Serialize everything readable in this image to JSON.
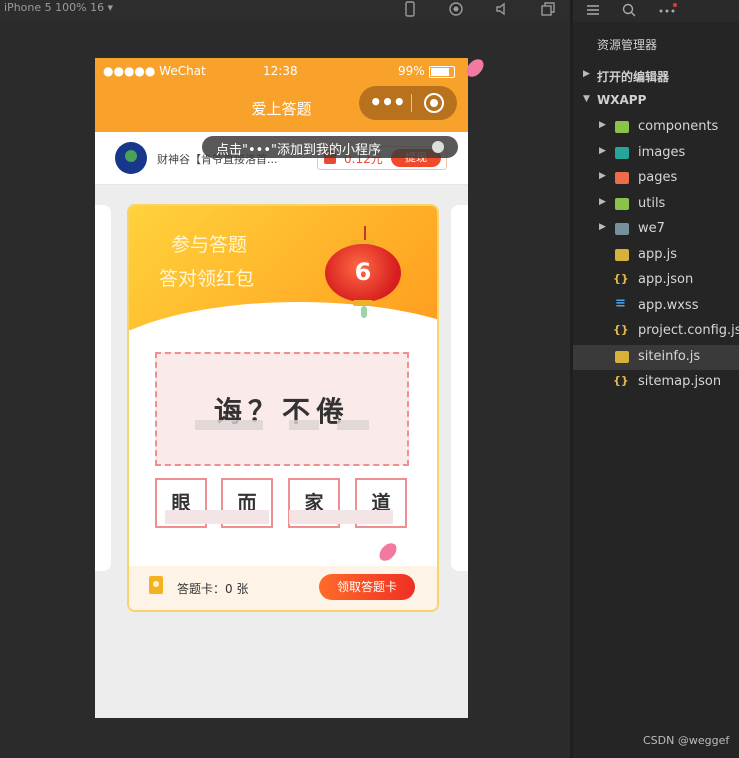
{
  "toolbar": {
    "device": "iPhone 5 100% 16 ▾"
  },
  "phone": {
    "status": {
      "carrier": "●●●●● WeChat",
      "time": "12:38",
      "battery_text": "99%"
    },
    "nav": {
      "title": "爱上答题",
      "capsule_more": "•••"
    },
    "ad": {
      "text": "财神谷【肯爷直接洛首...",
      "amount": "0.12元",
      "button": "提现"
    },
    "tip": {
      "text": "点击\"•••\"添加到我的小程序"
    },
    "card": {
      "head_line1": "参与答题",
      "head_line2": "答对领红包",
      "lantern_number": "6",
      "question": "诲？不倦",
      "options": [
        "眼",
        "而",
        "家",
        "道"
      ],
      "footer_label": "答题卡：0 张",
      "claim_button": "领取答题卡"
    }
  },
  "explorer": {
    "title": "资源管理器",
    "open_editors": "打开的编辑器",
    "project": "WXAPP",
    "items": [
      {
        "label": "components",
        "icon": "folder-components-icon",
        "color": "#8bc34a"
      },
      {
        "label": "images",
        "icon": "folder-images-icon",
        "color": "#26a69a"
      },
      {
        "label": "pages",
        "icon": "folder-pages-icon",
        "color": "#ef6c4a"
      },
      {
        "label": "utils",
        "icon": "folder-utils-icon",
        "color": "#8bc34a"
      },
      {
        "label": "we7",
        "icon": "folder-icon",
        "color": "#78909c"
      },
      {
        "label": "app.js",
        "icon": "js-file-icon"
      },
      {
        "label": "app.json",
        "icon": "json-file-icon"
      },
      {
        "label": "app.wxss",
        "icon": "wxss-file-icon"
      },
      {
        "label": "project.config.json",
        "icon": "json-file-icon"
      },
      {
        "label": "siteinfo.js",
        "icon": "js-file-icon"
      },
      {
        "label": "sitemap.json",
        "icon": "json-file-icon"
      }
    ]
  },
  "watermark": "CSDN @weggef"
}
